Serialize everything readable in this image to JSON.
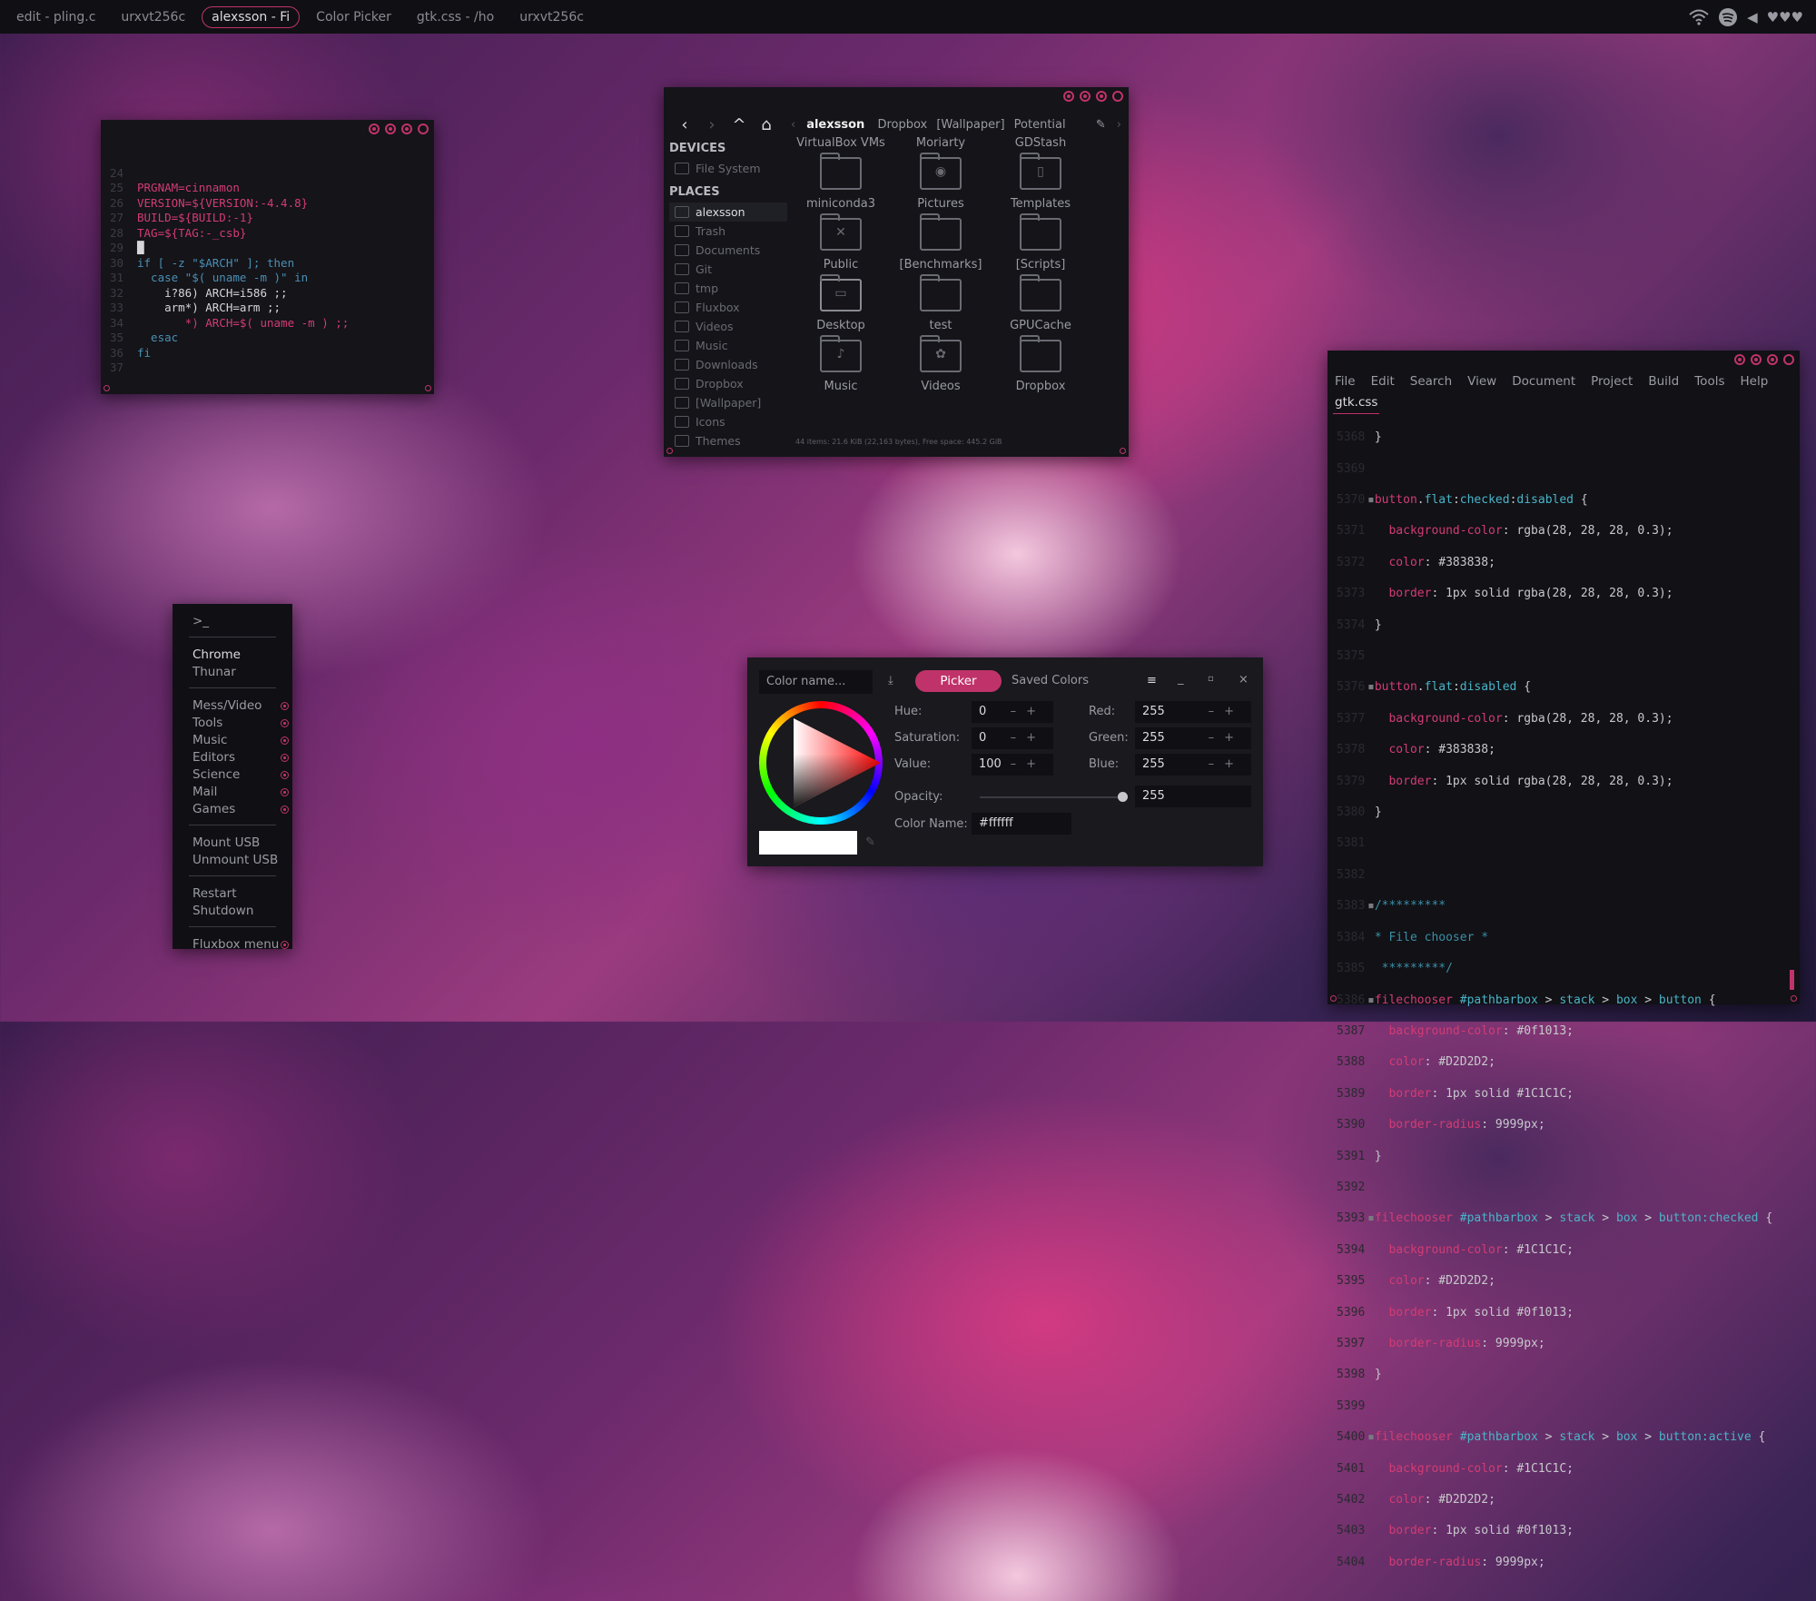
{
  "taskbar": {
    "tabs": [
      "edit - pling.c",
      "urxvt256c",
      "alexsson - Fi",
      "Color Picker",
      "gtk.css - /ho",
      "urxvt256c"
    ],
    "active_index": 2,
    "tray": {
      "wifi": "wifi-icon",
      "music": "spotify-icon",
      "volume": "◀",
      "hearts": "♥♥♥"
    }
  },
  "terminal": {
    "lines": [
      {
        "n": "24",
        "t": ""
      },
      {
        "n": "25",
        "t": "PRGNAM=cinnamon"
      },
      {
        "n": "26",
        "t": "VERSION=${VERSION:-4.4.8}"
      },
      {
        "n": "27",
        "t": "BUILD=${BUILD:-1}"
      },
      {
        "n": "28",
        "t": "TAG=${TAG:-_csb}"
      },
      {
        "n": "29",
        "t": "█"
      },
      {
        "n": "30",
        "t": "if [ -z \"$ARCH\" ]; then"
      },
      {
        "n": "31",
        "t": "  case \"$( uname -m )\" in"
      },
      {
        "n": "32",
        "t": "    i?86) ARCH=i586 ;;"
      },
      {
        "n": "33",
        "t": "    arm*) ARCH=arm ;;"
      },
      {
        "n": "34",
        "t": "       *) ARCH=$( uname -m ) ;;"
      },
      {
        "n": "35",
        "t": "  esac"
      },
      {
        "n": "36",
        "t": "fi"
      },
      {
        "n": "37",
        "t": ""
      }
    ]
  },
  "filemanager": {
    "breadcrumb": [
      "alexsson",
      "Dropbox",
      "[Wallpaper]",
      "Potential"
    ],
    "devices_label": "DEVICES",
    "devices": [
      "File System"
    ],
    "places_label": "PLACES",
    "places": [
      "alexsson",
      "Trash",
      "Documents",
      "Git",
      "tmp",
      "Fluxbox",
      "Videos",
      "Music",
      "Downloads",
      "Dropbox",
      "[Wallpaper]",
      "Icons",
      "Themes"
    ],
    "top_row": [
      "VirtualBox VMs",
      "Moriarty",
      "GDStash"
    ],
    "items": [
      "miniconda3",
      "Pictures",
      "Templates",
      "Public",
      "[Benchmarks]",
      "[Scripts]",
      "Desktop",
      "test",
      "GPUCache",
      "Music",
      "Videos",
      "Dropbox"
    ],
    "status": "44 items: 21.6 KiB (22,163 bytes), Free space: 445.2 GiB"
  },
  "menu": {
    "prompt": ">_",
    "apps": [
      "Chrome",
      "Thunar"
    ],
    "submenus": [
      "Mess/Video",
      "Tools",
      "Music",
      "Editors",
      "Science",
      "Mail",
      "Games"
    ],
    "usb": [
      "Mount USB",
      "Unmount USB"
    ],
    "power": [
      "Restart",
      "Shutdown"
    ],
    "footer": "Fluxbox menu"
  },
  "colorpicker": {
    "name_placeholder": "Color name...",
    "tab_picker": "Picker",
    "tab_saved": "Saved Colors",
    "hue_label": "Hue:",
    "hue": "0",
    "sat_label": "Saturation:",
    "sat": "0",
    "val_label": "Value:",
    "val": "100",
    "red_label": "Red:",
    "red": "255",
    "green_label": "Green:",
    "green": "255",
    "blue_label": "Blue:",
    "blue": "255",
    "opacity_label": "Opacity:",
    "opacity": "255",
    "opacity_fraction": 1.0,
    "colorname_label": "Color Name:",
    "colorname": "#ffffff",
    "swatch": "#ffffff"
  },
  "editor": {
    "menu": [
      "File",
      "Edit",
      "Search",
      "View",
      "Document",
      "Project",
      "Build",
      "Tools",
      "Help"
    ],
    "tab": "gtk.css",
    "accent": "#c0336a"
  }
}
